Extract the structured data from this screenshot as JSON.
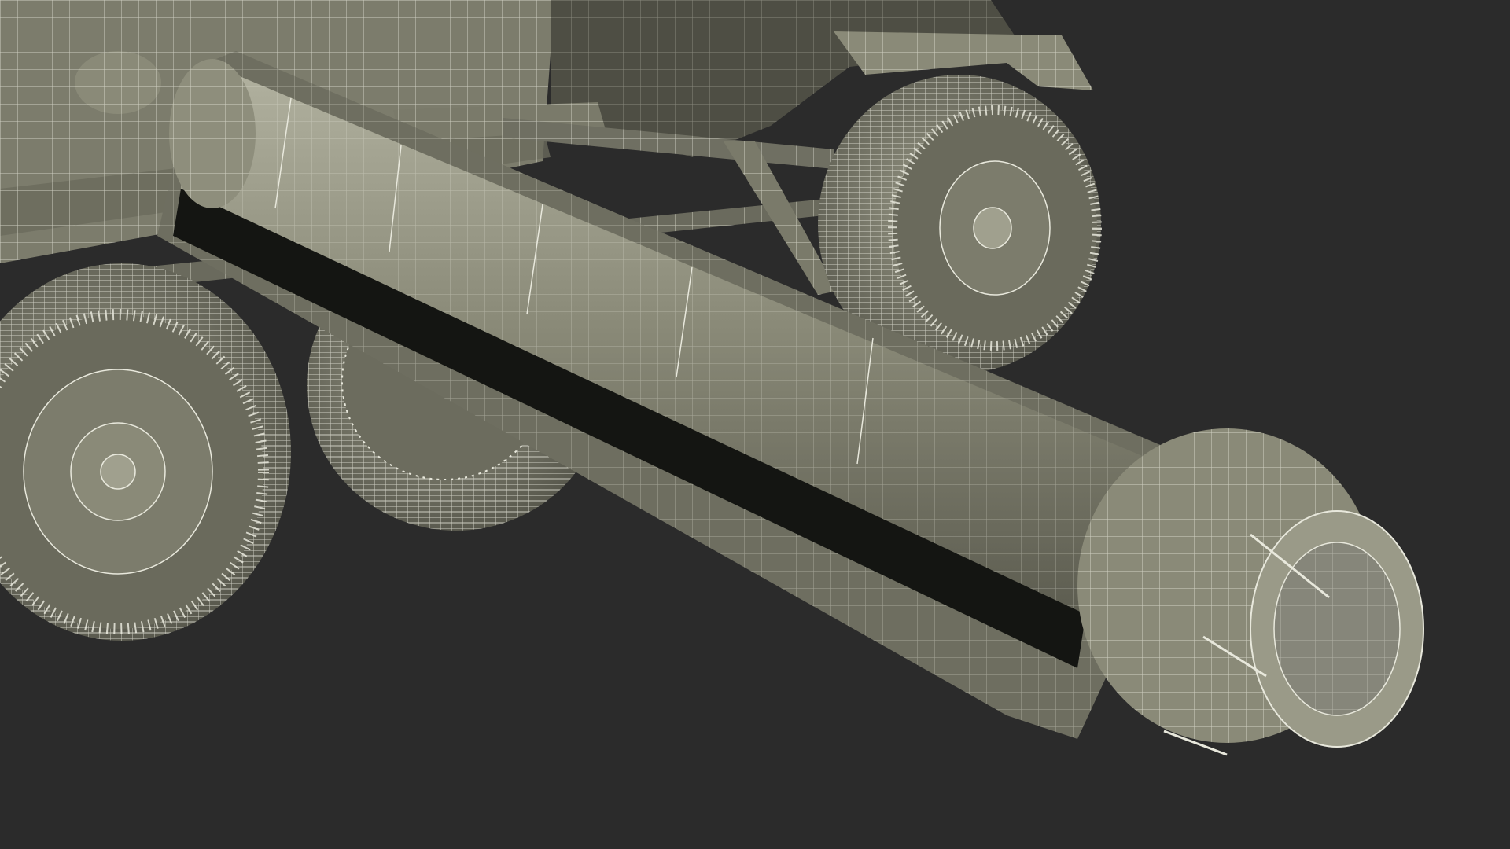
{
  "colors": {
    "background": "#2b2b2b",
    "surface": "#80806f",
    "surface_light": "#9a9a88",
    "surface_dark": "#4e4e44",
    "wire": "#e8e8dc",
    "slot": "#141512"
  },
  "objects": [
    {
      "name": "trailer-body",
      "icon": "wireframe-panel"
    },
    {
      "name": "tube-assembly",
      "icon": "wireframe-cylinder"
    },
    {
      "name": "wheel-front-right",
      "icon": "wireframe-wheel"
    },
    {
      "name": "wheel-left-front",
      "icon": "wireframe-wheel"
    },
    {
      "name": "wheel-left-rear",
      "icon": "wireframe-wheel"
    }
  ]
}
